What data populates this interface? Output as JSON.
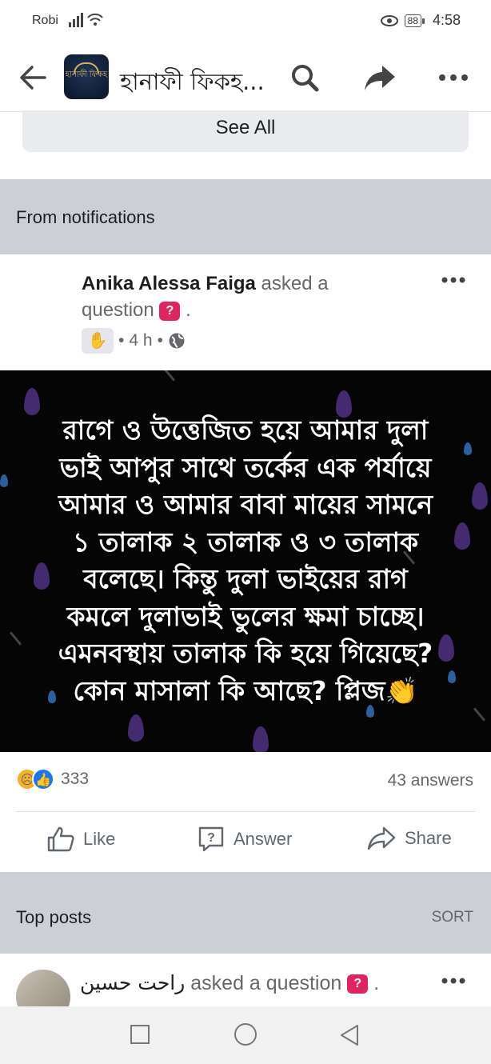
{
  "status_bar": {
    "carrier": "Robi",
    "battery": "88",
    "time": "4:58"
  },
  "header": {
    "group_name": "হানাফী ফিকহ...",
    "logo_text": "হানাফী ফিকহ"
  },
  "see_all": "See All",
  "notifications_section": {
    "title": "From notifications"
  },
  "post": {
    "author": "Anika Alessa Faiga",
    "action_prefix": " asked a",
    "action_suffix": "question",
    "meta_time": "4 h",
    "image_text": [
      "রাগে ও উত্তেজিত হয়ে আমার দুলা",
      "ভাই আপুর সাথে তর্কের এক পর্যায়ে",
      "আমার ও আমার বাবা মায়ের সামনে",
      "১ তালাক ২ তালাক ও ৩ তালাক",
      "বলেছে। কিন্তু দুলা ভাইয়ের রাগ",
      "কমলে দুলাভাই ভুলের ক্ষমা চাচ্ছে।",
      "এমনবস্থায় তালাক কি হয়ে গিয়েছে?",
      "কোন মাসালা কি আছে? প্লিজ👏"
    ],
    "reaction_count": "333",
    "answers": "43 answers",
    "actions": {
      "like": "Like",
      "answer": "Answer",
      "share": "Share"
    }
  },
  "top_posts": {
    "title": "Top posts",
    "sort": "SORT"
  },
  "post2": {
    "author": "راحت حسين",
    "action": " asked a question",
    "suffix": " ."
  },
  "icons": [
    "back-arrow-icon",
    "search-icon",
    "share-icon",
    "more-icon",
    "question-icon",
    "globe-icon",
    "wave-badge-icon",
    "like-icon",
    "answer-icon",
    "share-arrow-icon",
    "square-nav-icon",
    "circle-nav-icon",
    "triangle-nav-icon"
  ],
  "colors": {
    "question_badge": "#e0245e",
    "like_blue": "#1877f2",
    "section_gray": "#ccd0d5",
    "drop_purple": "#4b2f7a"
  }
}
